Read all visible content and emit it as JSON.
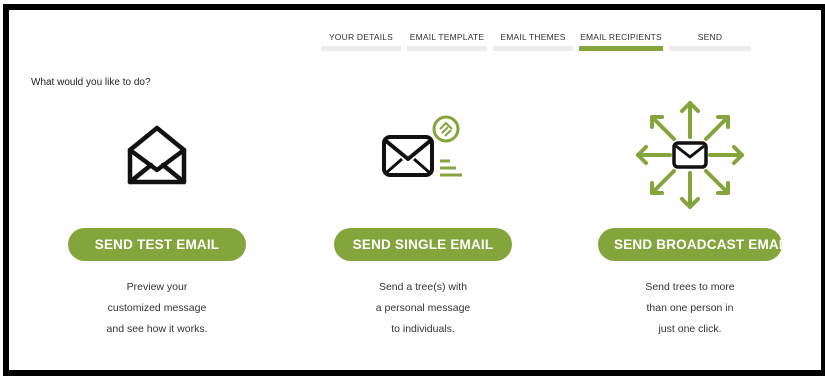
{
  "steps": [
    {
      "label": "YOUR DETAILS",
      "active": false
    },
    {
      "label": "EMAIL TEMPLATE",
      "active": false
    },
    {
      "label": "EMAIL THEMES",
      "active": false
    },
    {
      "label": "EMAIL RECIPIENTS",
      "active": true
    },
    {
      "label": "SEND",
      "active": false
    }
  ],
  "prompt": "What would you like to do?",
  "options": [
    {
      "icon": "envelope-open-icon",
      "button_label": "SEND TEST EMAIL",
      "description": [
        "Preview your",
        "customized message",
        "and see how it works."
      ]
    },
    {
      "icon": "envelope-single-icon",
      "button_label": "SEND SINGLE EMAIL",
      "description": [
        "Send a tree(s) with",
        "a personal message",
        "to individuals."
      ]
    },
    {
      "icon": "envelope-broadcast-icon",
      "button_label": "SEND BROADCAST EMAIL",
      "description": [
        "Send trees to more",
        "than one person in",
        "just one click."
      ]
    }
  ],
  "colors": {
    "accent": "#84a43c",
    "step_bar_inactive": "#ececec",
    "frame_border": "#000000",
    "text": "#333333"
  }
}
